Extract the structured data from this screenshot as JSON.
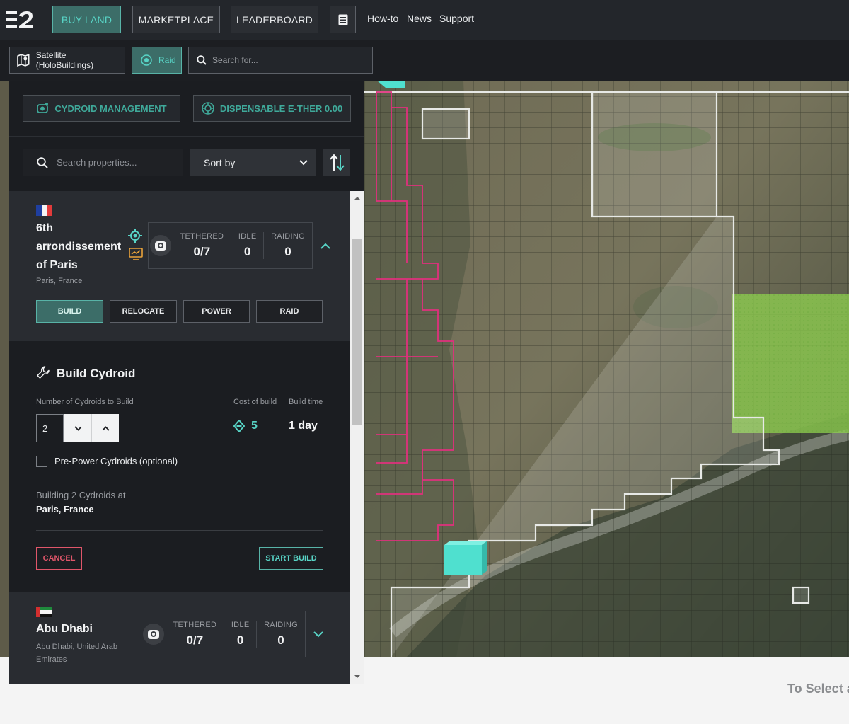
{
  "nav": {
    "buy_land": "BUY LAND",
    "marketplace": "MARKETPLACE",
    "leaderboard": "LEADERBOARD",
    "howto": "How-to",
    "news": "News",
    "support": "Support"
  },
  "subnav": {
    "satellite": "Satellite (HoloBuildings)",
    "raid": "Raid",
    "search_placeholder": "Search for..."
  },
  "panel": {
    "cydroid_management": "CYDROID MANAGEMENT",
    "dispensable": "DISPENSABLE E-THER 0.00",
    "search_placeholder": "Search properties...",
    "sort_label": "Sort by"
  },
  "property1": {
    "name": "6th arrondissement of Paris",
    "location": "Paris, France",
    "tethered_label": "TETHERED",
    "tethered": "0/7",
    "idle_label": "IDLE",
    "idle": "0",
    "raiding_label": "RAIDING",
    "raiding": "0",
    "actions": {
      "build": "BUILD",
      "relocate": "RELOCATE",
      "power": "POWER",
      "raid": "RAID"
    }
  },
  "build": {
    "title": "Build Cydroid",
    "count_label": "Number of Cydroids to Build",
    "count_value": "2",
    "cost_label": "Cost of build",
    "cost_value": "5",
    "time_label": "Build time",
    "time_value": "1 day",
    "prepower_label": "Pre-Power Cydroids (optional)",
    "summary_line": "Building 2 Cydroids at",
    "summary_place": "Paris, France",
    "cancel": "CANCEL",
    "start": "START BUILD"
  },
  "property2": {
    "name": "Abu Dhabi",
    "location": "Abu Dhabi, United Arab Emirates",
    "tethered_label": "TETHERED",
    "tethered": "0/7",
    "idle_label": "IDLE",
    "idle": "0",
    "raiding_label": "RAIDING",
    "raiding": "0"
  },
  "footer_hint": "To Select an",
  "colors": {
    "accent": "#58d4c6",
    "accent_dark": "#3c6d68",
    "cancel": "#e0566a",
    "raid_outline": "#e0307d",
    "selection_fill": "#8fd14f"
  }
}
